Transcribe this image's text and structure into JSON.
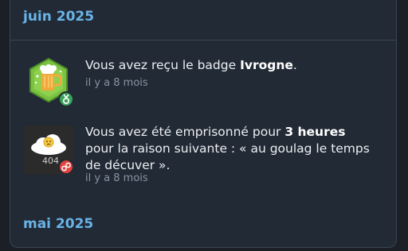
{
  "sections": [
    {
      "month": "juin 2025"
    },
    {
      "month": "mai 2025"
    }
  ],
  "notifications": [
    {
      "text_before": "Vous avez reçu le badge ",
      "text_bold": "Ivrogne",
      "text_after": ".",
      "time": "il y a 8 mois",
      "avatar_icon": "beer-badge-icon",
      "type_icon": "medal-icon",
      "type_color": "#3aa35a"
    },
    {
      "line1_before": "Vous avez été emprisonné pour ",
      "line1_bold": "3 heures",
      "line2": "pour la raison suivante : « au goulag le temps",
      "line3": "de décuver ».",
      "time": "il y a 8 mois",
      "avatar_label": "404",
      "avatar_icon": "cloud-404-icon",
      "type_icon": "handcuffs-icon",
      "type_color": "#e0443e"
    }
  ],
  "colors": {
    "background": "#1b1f26",
    "panel": "#222a35",
    "accent": "#69b4e8"
  }
}
